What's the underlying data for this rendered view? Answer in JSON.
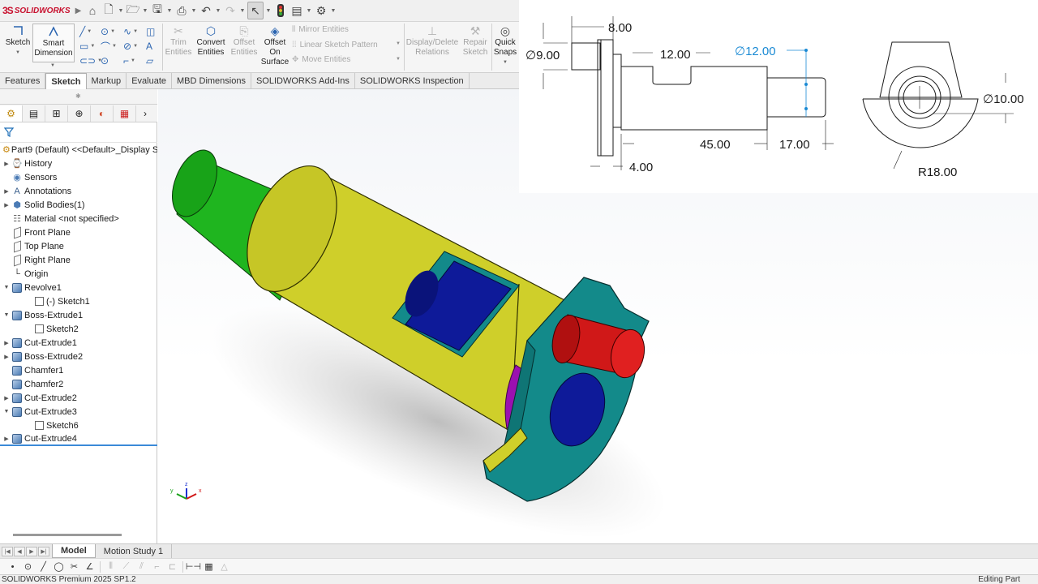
{
  "app": {
    "brand_prefix": "3S",
    "brand_name": "SOLIDWORKS",
    "status_left": "SOLIDWORKS Premium 2025 SP1.2",
    "status_right": "Editing Part"
  },
  "quick_access": {
    "icons": [
      "home-icon",
      "new-document-icon",
      "open-icon",
      "save-icon",
      "print-icon",
      "undo-icon",
      "redo-icon",
      "select-arrow-icon",
      "traffic-light-icon",
      "file-properties-icon",
      "options-gear-icon"
    ]
  },
  "command_manager": {
    "sketch_label": "Sketch",
    "smart_dimension_label": [
      "Smart",
      "Dimension"
    ],
    "trim_entities_label": [
      "Trim",
      "Entities"
    ],
    "convert_entities_label": [
      "Convert",
      "Entities"
    ],
    "offset_entities_label": [
      "Offset",
      "Entities"
    ],
    "offset_on_surface_label": [
      "Offset",
      "On",
      "Surface"
    ],
    "mirror_entities_label": "Mirror Entities",
    "linear_sketch_pattern_label": "Linear Sketch Pattern",
    "move_entities_label": "Move Entities",
    "display_delete_relations_label": [
      "Display/Delete",
      "Relations"
    ],
    "repair_sketch_label": [
      "Repair",
      "Sketch"
    ],
    "quick_snaps_label": [
      "Quick",
      "Snaps"
    ]
  },
  "command_tabs": [
    {
      "label": "Features",
      "active": false
    },
    {
      "label": "Sketch",
      "active": true
    },
    {
      "label": "Markup",
      "active": false
    },
    {
      "label": "Evaluate",
      "active": false
    },
    {
      "label": "MBD Dimensions",
      "active": false
    },
    {
      "label": "SOLIDWORKS Add-Ins",
      "active": false
    },
    {
      "label": "SOLIDWORKS Inspection",
      "active": false
    }
  ],
  "feature_tree": {
    "root": "Part9 (Default) <<Default>_Display S",
    "items": [
      {
        "label": "History",
        "icon": "history-icon",
        "expandable": true,
        "indent": 0
      },
      {
        "label": "Sensors",
        "icon": "sensors-icon",
        "expandable": false,
        "indent": 0
      },
      {
        "label": "Annotations",
        "icon": "annotations-icon",
        "expandable": true,
        "indent": 0
      },
      {
        "label": "Solid Bodies(1)",
        "icon": "solid-bodies-icon",
        "expandable": true,
        "indent": 0
      },
      {
        "label": "Material <not specified>",
        "icon": "material-icon",
        "expandable": false,
        "indent": 0
      },
      {
        "label": "Front Plane",
        "icon": "plane-icon",
        "expandable": false,
        "indent": 0
      },
      {
        "label": "Top Plane",
        "icon": "plane-icon",
        "expandable": false,
        "indent": 0
      },
      {
        "label": "Right Plane",
        "icon": "plane-icon",
        "expandable": false,
        "indent": 0
      },
      {
        "label": "Origin",
        "icon": "origin-icon",
        "expandable": false,
        "indent": 0
      },
      {
        "label": "Revolve1",
        "icon": "revolve-icon",
        "expandable": true,
        "expanded": true,
        "indent": 0
      },
      {
        "label": "(-) Sketch1",
        "icon": "sketch-icon",
        "expandable": false,
        "indent": 1
      },
      {
        "label": "Boss-Extrude1",
        "icon": "extrude-icon",
        "expandable": true,
        "expanded": true,
        "indent": 0
      },
      {
        "label": "Sketch2",
        "icon": "sketch-icon",
        "expandable": false,
        "indent": 1
      },
      {
        "label": "Cut-Extrude1",
        "icon": "cut-extrude-icon",
        "expandable": true,
        "indent": 0
      },
      {
        "label": "Boss-Extrude2",
        "icon": "extrude-icon",
        "expandable": true,
        "indent": 0
      },
      {
        "label": "Chamfer1",
        "icon": "chamfer-icon",
        "expandable": false,
        "indent": 0
      },
      {
        "label": "Chamfer2",
        "icon": "chamfer-icon",
        "expandable": false,
        "indent": 0
      },
      {
        "label": "Cut-Extrude2",
        "icon": "cut-extrude-icon",
        "expandable": true,
        "indent": 0
      },
      {
        "label": "Cut-Extrude3",
        "icon": "cut-extrude-icon",
        "expandable": true,
        "expanded": true,
        "indent": 0
      },
      {
        "label": "Sketch6",
        "icon": "sketch-icon",
        "expandable": false,
        "indent": 1
      },
      {
        "label": "Cut-Extrude4",
        "icon": "cut-extrude-icon",
        "expandable": true,
        "indent": 0
      }
    ]
  },
  "drawing": {
    "dims": {
      "d_8": "8.00",
      "d_dia9": "∅9.00",
      "d_12": "12.00",
      "d_dia12": "∅12.00",
      "d_45": "45.00",
      "d_17": "17.00",
      "d_4": "4.00",
      "d_dia10": "∅10.00",
      "d_r18": "R18.00"
    }
  },
  "model_colors": {
    "shaft_green": "#1fb51f",
    "body_yellow": "#cfcf2a",
    "slot_blue": "#0e1a99",
    "flange_teal": "#138a8a",
    "pin_red": "#d01818",
    "accent_purple": "#9a10b0"
  },
  "bottom_tabs": [
    {
      "label": "Model",
      "active": true
    },
    {
      "label": "Motion Study 1",
      "active": false
    }
  ],
  "shortcut_bar": {
    "icons": [
      "point-icon",
      "circle-icon",
      "line-icon",
      "polygon-icon",
      "trim-icon",
      "convert-icon",
      "mirror-icon",
      "offset-icon",
      "pattern-icon",
      "fillet-icon",
      "construction-icon",
      "dimension-icon",
      "grid-icon",
      "relation-icon"
    ]
  }
}
